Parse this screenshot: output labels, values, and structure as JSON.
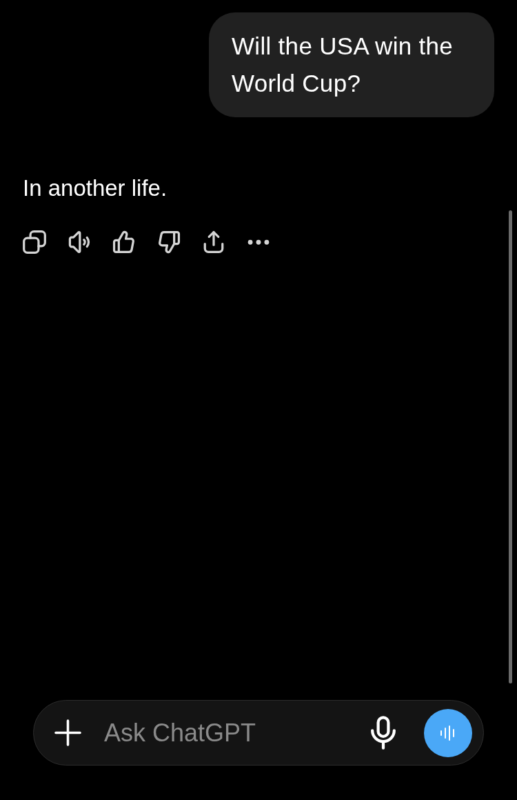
{
  "messages": [
    {
      "kind": "user",
      "text": "Will the USA win the World Cup?"
    },
    {
      "kind": "assistant",
      "text": "In another life."
    }
  ],
  "composer": {
    "placeholder": "Ask ChatGPT"
  }
}
